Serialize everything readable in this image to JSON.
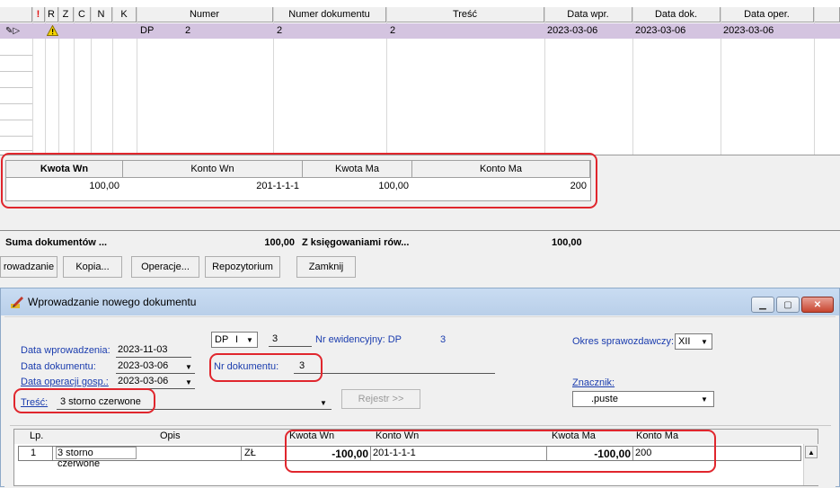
{
  "grid": {
    "columns": [
      "!",
      "R",
      "Z",
      "C",
      "N",
      "K",
      "Numer",
      "Numer dokumentu",
      "Treść",
      "Data wpr.",
      "Data dok.",
      "Data oper."
    ],
    "row": {
      "numer_prefix": "DP",
      "numer": "2",
      "numer_dokumentu": "2",
      "tresc": "2",
      "data_wpr": "2023-03-06",
      "data_dok": "2023-03-06",
      "data_oper": "2023-03-06"
    }
  },
  "postings": {
    "headers": [
      "Kwota Wn",
      "Konto Wn",
      "Kwota Ma",
      "Konto Ma"
    ],
    "row": {
      "kwota_wn": "100,00",
      "konto_wn": "201-1-1-1",
      "kwota_ma": "100,00",
      "konto_ma": "200"
    }
  },
  "summary": {
    "label1": "Suma dokumentów ...",
    "value1": "100,00",
    "label2": "Z księgowaniami rów...",
    "value2": "100,00"
  },
  "buttons": {
    "wprowadzanie": "rowadzanie",
    "kopia": "Kopia...",
    "operacje": "Operacje...",
    "repozytorium": "Repozytorium",
    "zamknij": "Zamknij"
  },
  "dialog": {
    "title": "Wprowadzanie nowego dokumentu",
    "typ": "DP",
    "typ_sub": "I",
    "numer": "3",
    "nr_ewidencyjny_label": "Nr ewidencyjny: DP",
    "nr_ewidencyjny": "3",
    "okres_label": "Okres sprawozdawczy:",
    "okres": "XII",
    "data_wprowadzenia_label": "Data wprowadzenia:",
    "data_wprowadzenia": "2023-11-03",
    "data_dokumentu_label": "Data dokumentu:",
    "data_dokumentu": "2023-03-06",
    "data_operacji_label": "Data operacji gosp.:",
    "data_operacji": "2023-03-06",
    "nr_dokumentu_label": "Nr dokumentu:",
    "nr_dokumentu": "3",
    "tresc_label": "Treść:",
    "tresc": "3 storno czerwone",
    "rejestr_label": "Rejestr >>",
    "znacznik_label": "Znacznik:",
    "znacznik": ".puste",
    "grid_headers": {
      "lp": "Lp.",
      "opis": "Opis",
      "kwota_wn": "Kwota Wn",
      "konto_wn": "Konto Wn",
      "kwota_ma": "Kwota Ma",
      "konto_ma": "Konto Ma"
    },
    "grid_row": {
      "lp": "1",
      "opis": "3 storno czerwone",
      "waluta": "ZŁ",
      "kwota_wn": "-100,00",
      "konto_wn": "201-1-1-1",
      "kwota_ma": "-100,00",
      "konto_ma": "200"
    }
  }
}
